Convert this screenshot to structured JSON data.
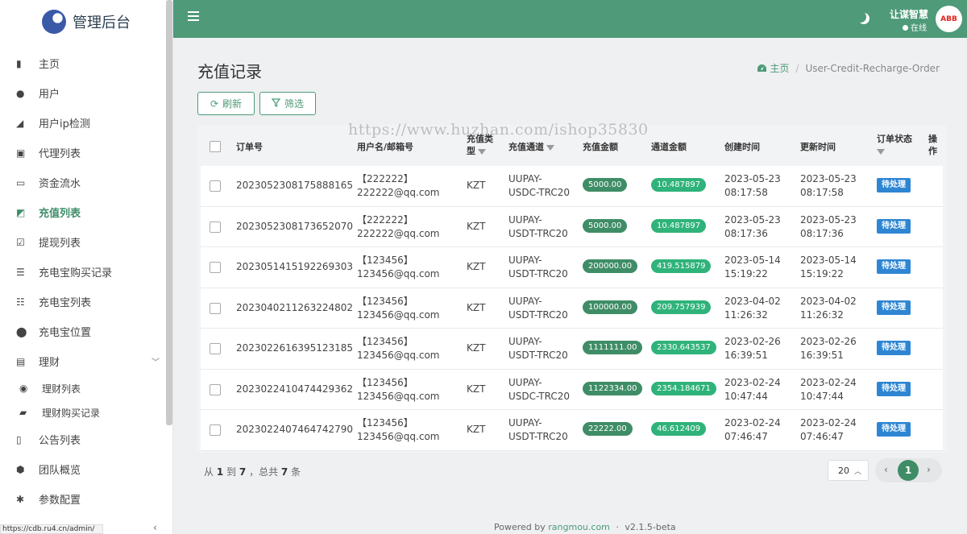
{
  "sidebar": {
    "logo_text": "管理后台",
    "items": [
      {
        "label": "主页",
        "icon": "bar-chart-icon"
      },
      {
        "label": "用户",
        "icon": "user-icon"
      },
      {
        "label": "用户ip检测",
        "icon": "signal-icon"
      },
      {
        "label": "代理列表",
        "icon": "id-card-icon"
      },
      {
        "label": "资金流水",
        "icon": "money-icon"
      },
      {
        "label": "充值列表",
        "icon": "recharge-icon"
      },
      {
        "label": "提现列表",
        "icon": "check-square-icon"
      },
      {
        "label": "充电宝购买记录",
        "icon": "list-icon"
      },
      {
        "label": "充电宝列表",
        "icon": "list-alt-icon"
      },
      {
        "label": "充电宝位置",
        "icon": "location-icon"
      },
      {
        "label": "理财",
        "icon": "archive-icon"
      },
      {
        "label": "理财列表",
        "icon": "compass-icon"
      },
      {
        "label": "理财购买记录",
        "icon": "folder-open-icon"
      },
      {
        "label": "公告列表",
        "icon": "file-icon"
      },
      {
        "label": "团队概览",
        "icon": "users-icon"
      },
      {
        "label": "参数配置",
        "icon": "cogs-icon"
      }
    ],
    "status_url": "https://cdb.ru4.cn/admin/"
  },
  "topbar": {
    "user_name": "让谋智慧",
    "user_status": "在线",
    "avatar_text": "ABB"
  },
  "page": {
    "title": "充值记录",
    "breadcrumb_home": "主页",
    "breadcrumb_current": "User-Credit-Recharge-Order",
    "refresh_label": "刷新",
    "filter_label": "筛选",
    "watermark": "https://www.huzhan.com/ishop35830"
  },
  "table": {
    "headers": {
      "order_no": "订单号",
      "user": "用户名/邮箱号",
      "type_1": "充值类",
      "type_2": "型",
      "channel": "充值通道",
      "amount": "充值金额",
      "channel_amount": "通道金额",
      "created": "创建时间",
      "updated": "更新时间",
      "status": "订单状态",
      "op_1": "操",
      "op_2": "作"
    },
    "rows": [
      {
        "order_no": "2023052308175888165",
        "user_1": "【222222】",
        "user_2": "222222@qq.com",
        "type": "KZT",
        "ch_1": "UUPAY-",
        "ch_2": "USDC-TRC20",
        "amount": "5000.00",
        "ch_amount": "10.487897",
        "c_date": "2023-05-23",
        "c_time": "08:17:58",
        "u_date": "2023-05-23",
        "u_time": "08:17:58",
        "status": "待处理"
      },
      {
        "order_no": "2023052308173652070",
        "user_1": "【222222】",
        "user_2": "222222@qq.com",
        "type": "KZT",
        "ch_1": "UUPAY-",
        "ch_2": "USDT-TRC20",
        "amount": "5000.00",
        "ch_amount": "10.487897",
        "c_date": "2023-05-23",
        "c_time": "08:17:36",
        "u_date": "2023-05-23",
        "u_time": "08:17:36",
        "status": "待处理"
      },
      {
        "order_no": "2023051415192269303",
        "user_1": "【123456】",
        "user_2": "123456@qq.com",
        "type": "KZT",
        "ch_1": "UUPAY-",
        "ch_2": "USDT-TRC20",
        "amount": "200000.00",
        "ch_amount": "419.515879",
        "c_date": "2023-05-14",
        "c_time": "15:19:22",
        "u_date": "2023-05-14",
        "u_time": "15:19:22",
        "status": "待处理"
      },
      {
        "order_no": "2023040211263224802",
        "user_1": "【123456】",
        "user_2": "123456@qq.com",
        "type": "KZT",
        "ch_1": "UUPAY-",
        "ch_2": "USDT-TRC20",
        "amount": "100000.00",
        "ch_amount": "209.757939",
        "c_date": "2023-04-02",
        "c_time": "11:26:32",
        "u_date": "2023-04-02",
        "u_time": "11:26:32",
        "status": "待处理"
      },
      {
        "order_no": "2023022616395123185",
        "user_1": "【123456】",
        "user_2": "123456@qq.com",
        "type": "KZT",
        "ch_1": "UUPAY-",
        "ch_2": "USDT-TRC20",
        "amount": "1111111.00",
        "ch_amount": "2330.643537",
        "c_date": "2023-02-26",
        "c_time": "16:39:51",
        "u_date": "2023-02-26",
        "u_time": "16:39:51",
        "status": "待处理"
      },
      {
        "order_no": "2023022410474429362",
        "user_1": "【123456】",
        "user_2": "123456@qq.com",
        "type": "KZT",
        "ch_1": "UUPAY-",
        "ch_2": "USDC-TRC20",
        "amount": "1122334.00",
        "ch_amount": "2354.184671",
        "c_date": "2023-02-24",
        "c_time": "10:47:44",
        "u_date": "2023-02-24",
        "u_time": "10:47:44",
        "status": "待处理"
      },
      {
        "order_no": "2023022407464742790",
        "user_1": "【123456】",
        "user_2": "123456@qq.com",
        "type": "KZT",
        "ch_1": "UUPAY-",
        "ch_2": "USDT-TRC20",
        "amount": "22222.00",
        "ch_amount": "46.612409",
        "c_date": "2023-02-24",
        "c_time": "07:46:47",
        "u_date": "2023-02-24",
        "u_time": "07:46:47",
        "status": "待处理"
      }
    ]
  },
  "pagination": {
    "info_prefix": "从",
    "from": "1",
    "to_word": "到",
    "to": "7",
    "total_prefix": "，总共",
    "total": "7",
    "total_suffix": "条",
    "per_page": "20",
    "current_page": "1"
  },
  "footer": {
    "powered_by": "Powered by",
    "link": "rangmou.com",
    "sep": "·",
    "version": "v2.1.5-beta"
  },
  "colors": {
    "primary": "#4e9a79",
    "amount_pill": "#3f8d67",
    "channel_pill": "#2fb37a",
    "status_badge": "#2e86d3"
  }
}
